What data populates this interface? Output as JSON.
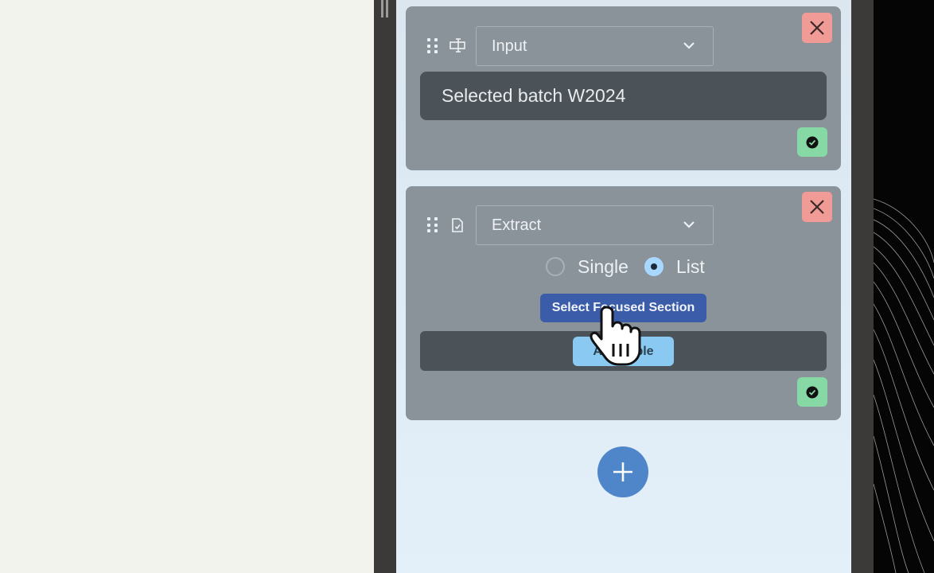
{
  "steps": [
    {
      "type_label": "Input",
      "type_icon": "text-input-icon",
      "value_text": "Selected batch W2024",
      "status": "valid"
    },
    {
      "type_label": "Extract",
      "type_icon": "document-icon",
      "mode_options": [
        {
          "label": "Single",
          "selected": false
        },
        {
          "label": "List",
          "selected": true
        }
      ],
      "select_section_label": "Select Focused Section",
      "add_table_label": "Add Table",
      "status": "valid"
    }
  ],
  "add_step_icon": "plus-icon",
  "colors": {
    "card_bg": "#8a939a",
    "close_bg": "#f19b97",
    "ok_bg": "#86d9a4",
    "primary_btn": "#3b5ca8",
    "secondary_btn": "#8ac9f2",
    "fab_bg": "#4e86c9"
  }
}
